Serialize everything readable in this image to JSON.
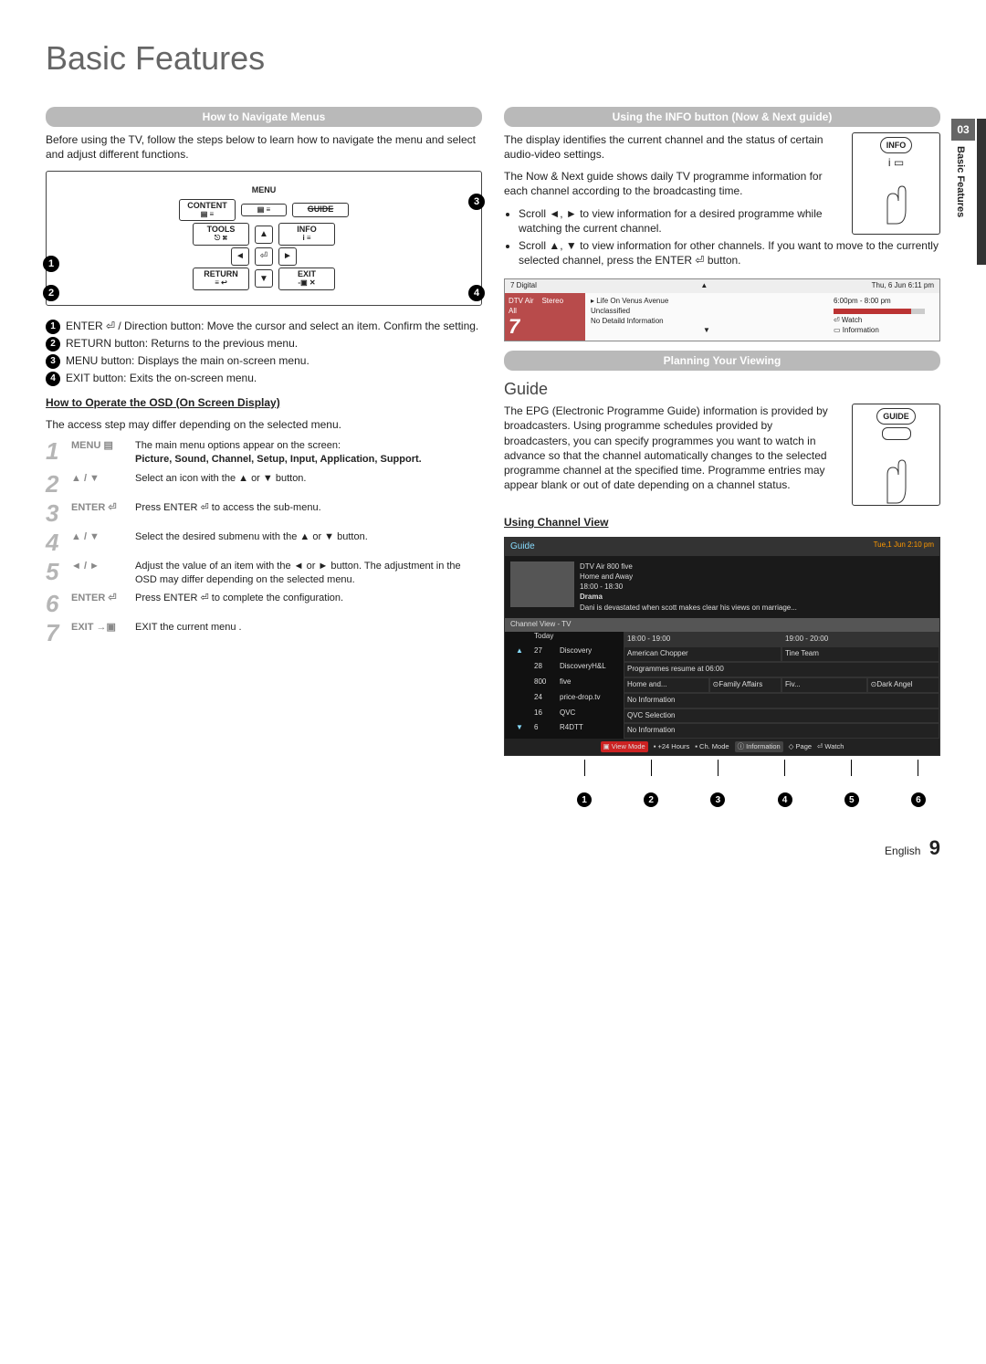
{
  "page": {
    "title": "Basic Features",
    "chapter_number": "03",
    "chapter_label": "Basic Features",
    "footer_lang": "English",
    "page_number": "9"
  },
  "left": {
    "sec1_title": "How to Navigate Menus",
    "sec1_intro": "Before using the TV, follow the steps below to learn how to navigate the menu and select and adjust different functions.",
    "remote": {
      "menu": "MENU",
      "content": "CONTENT",
      "guide": "GUIDE",
      "tools": "TOOLS",
      "info": "INFO",
      "return": "RETURN",
      "exit": "EXIT",
      "menu_icon": "▤ ≡",
      "content_icon": "▤ ≡",
      "tools_icon": "⎋ ⌘",
      "info_icon": "i ≡",
      "return_icon": "≡ ↩",
      "exit_icon": "-▣ ✕"
    },
    "legend": [
      "ENTER ⏎ / Direction button: Move the cursor and select an item. Confirm the setting.",
      "RETURN button: Returns to the previous menu.",
      "MENU button: Displays the main on-screen menu.",
      "EXIT button: Exits the on-screen menu."
    ],
    "osd_heading": "How to Operate the OSD (On Screen Display)",
    "osd_note": "The access step may differ depending on the selected menu.",
    "osd_steps": [
      {
        "n": "1",
        "key": "MENU ▤",
        "desc": "The main menu options appear on the screen:",
        "bold_line": "Picture, Sound, Channel, Setup, Input, Application, Support."
      },
      {
        "n": "2",
        "key": "▲ / ▼",
        "desc": "Select an icon with the ▲ or ▼ button."
      },
      {
        "n": "3",
        "key": "ENTER ⏎",
        "desc": "Press ENTER ⏎ to access the sub-menu."
      },
      {
        "n": "4",
        "key": "▲ / ▼",
        "desc": "Select the desired submenu with the ▲ or ▼ button."
      },
      {
        "n": "5",
        "key": "◄ / ►",
        "desc": "Adjust the value of an item with the ◄ or ► button. The adjustment in the OSD may differ depending on the selected menu."
      },
      {
        "n": "6",
        "key": "ENTER ⏎",
        "desc": "Press ENTER ⏎ to complete the configuration."
      },
      {
        "n": "7",
        "key": "EXIT →▣",
        "desc": "EXIT the current menu ."
      }
    ]
  },
  "right": {
    "sec2_title": "Using the INFO button (Now & Next guide)",
    "sec2_p1": "The display identifies the current channel and the status of certain audio-video settings.",
    "sec2_p2": "The Now & Next guide shows daily TV programme information for each channel according to the broadcasting time.",
    "info_button_label": "INFO",
    "sec2_bullets": [
      "Scroll ◄, ► to view information for a desired programme while watching the current channel.",
      "Scroll ▲, ▼ to view information for other channels. If you want to move to the currently selected channel, press the ENTER ⏎ button."
    ],
    "nownext": {
      "header_channel": "7 Digital",
      "header_date": "Thu, 6 Jun  6:11 pm",
      "left_line1": "DTV Air",
      "left_stereo": "Stereo",
      "left_line2": "All",
      "left_num": "7",
      "mid_title": "▸ Life On Venus Avenue",
      "mid_line2": "Unclassified",
      "mid_line3": "No Detaild Information",
      "right_time": "6:00pm - 8:00 pm",
      "right_watch": "⏎ Watch",
      "right_info": "▭ Information"
    },
    "sec3_title": "Planning Your Viewing",
    "guide_heading": "Guide",
    "guide_button_label": "GUIDE",
    "guide_p": "The EPG (Electronic Programme Guide) information is provided by broadcasters. Using programme schedules provided by broadcasters, you can specify programmes you want to watch in advance so that the channel automatically changes to the selected programme channel at the specified time. Programme entries may appear blank or out of date depending on a channel status.",
    "using_channel_view": "Using  Channel View",
    "guide_screen": {
      "title": "Guide",
      "clock": "Tue,1 Jun 2:10 pm",
      "meta_channel": "DTV Air 800 five",
      "meta_prog": "Home and Away",
      "meta_time": "18:00 - 18:30",
      "meta_genre": "Drama",
      "meta_desc": "Dani is devastated when scott makes clear his views on marriage...",
      "view_bar": "Channel View - TV",
      "today": "Today",
      "time1": "18:00 - 19:00",
      "time2": "19:00 - 20:00",
      "rows": [
        {
          "arrow": "▲",
          "num": "27",
          "name": "Discovery",
          "progs": [
            "American Chopper",
            "Tine Team"
          ]
        },
        {
          "arrow": "",
          "num": "28",
          "name": "DiscoveryH&L",
          "progs": [
            "Programmes resume at 06:00"
          ]
        },
        {
          "arrow": "",
          "num": "800",
          "name": "five",
          "progs": [
            "Home and...",
            "⊙Family Affairs",
            "Fiv...",
            "⊙Dark Angel"
          ]
        },
        {
          "arrow": "",
          "num": "24",
          "name": "price-drop.tv",
          "progs": [
            "No Information"
          ]
        },
        {
          "arrow": "",
          "num": "16",
          "name": "QVC",
          "progs": [
            "QVC Selection"
          ]
        },
        {
          "arrow": "▼",
          "num": "6",
          "name": "R4DTT",
          "progs": [
            "No Information"
          ]
        }
      ],
      "footer_items": [
        "▣ View Mode",
        "▪ +24 Hours",
        "▪ Ch. Mode",
        "ⓘ Information",
        "◇ Page",
        "⏎ Watch"
      ]
    }
  }
}
